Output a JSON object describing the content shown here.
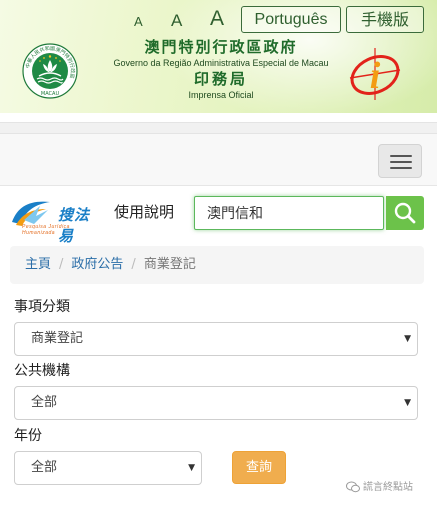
{
  "header": {
    "font_sizes": [
      "A",
      "A",
      "A"
    ],
    "lang_portuguese": "Português",
    "lang_mobile": "手機版",
    "gov_name_zh": "澳門特別行政區政府",
    "gov_name_pt": "Governo da Região Administrativa Especial de Macau",
    "office_name_zh": "印務局",
    "office_name_pt": "Imprensa Oficial",
    "emblem_caption": "MACAU",
    "emblem_ring_text": "中華人民共和國澳門特別行政區",
    "io_letter": "i"
  },
  "search": {
    "logo_text": "搜法易",
    "logo_sub": "Pesquisa Jurídica Humanizada",
    "help_label": "使用說明",
    "query_value": "澳門信和"
  },
  "breadcrumb": {
    "home": "主頁",
    "notices": "政府公告",
    "current": "商業登記"
  },
  "form": {
    "category_label": "事項分類",
    "category_value": "商業登記",
    "agency_label": "公共機構",
    "agency_value": "全部",
    "year_label": "年份",
    "year_value": "全部",
    "submit_label": "查詢"
  },
  "watermark": "謊言終點站",
  "colors": {
    "accent_green": "#6cc24a",
    "link_blue": "#2b6ea8",
    "query_orange": "#f0ad4e",
    "header_text_green": "#1f6b2a"
  }
}
